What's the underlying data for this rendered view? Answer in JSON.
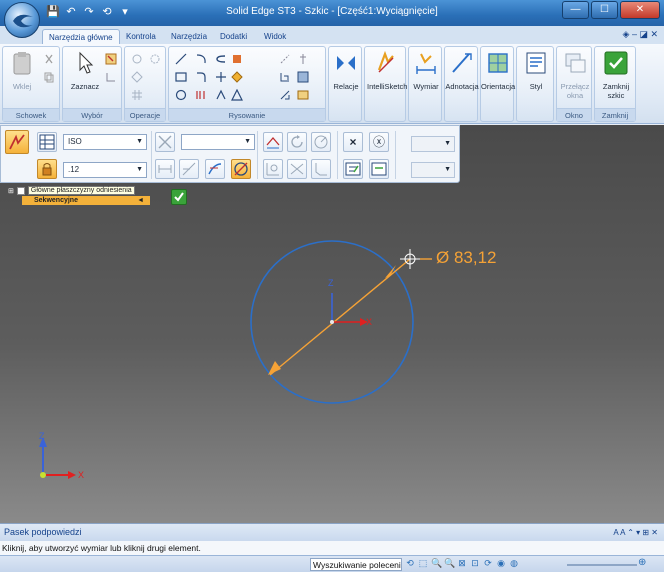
{
  "window": {
    "title": "Solid Edge ST3 - Szkic - [Część1:Wyciągnięcie]",
    "minimize": "—",
    "maximize": "☐",
    "close": "✕"
  },
  "qat": [
    "💾",
    "↶",
    "↷",
    "⟲",
    "▾"
  ],
  "tabs": [
    "Narzędzia główne",
    "Kontrola",
    "Narzędzia",
    "Dodatki",
    "Widok"
  ],
  "help_icons": "◈  –  ◪  ✕",
  "ribbon": {
    "groups": {
      "schowek": {
        "label": "Schowek",
        "wklej": "Wklej"
      },
      "wybor": {
        "label": "Wybór",
        "zaznacz": "Zaznacz"
      },
      "operacje": {
        "label": "Operacje"
      },
      "rysowanie": {
        "label": "Rysowanie"
      },
      "relacje": {
        "label": "Relacje"
      },
      "intellisketch": {
        "label": "IntelliSketch"
      },
      "wymiar": {
        "label": "Wymiar"
      },
      "adnotacja": {
        "label": "Adnotacja"
      },
      "orientacja": {
        "label": "Orientacja"
      },
      "styl": {
        "label": "Styl"
      },
      "okno": {
        "label": "Okno",
        "przelacz_okna_1": "Przełącz",
        "przelacz_okna_2": "okna"
      },
      "zamknij": {
        "label": "Zamknij",
        "zamknij_szkic_1": "Zamknij",
        "zamknij_szkic_2": "szkic"
      }
    }
  },
  "command_bar": {
    "standard": "ISO",
    "value": ".12",
    "btn_x": "×",
    "btn_xc": "ⓧ"
  },
  "tree": {
    "tooltip": "Główne płaszczyzny odniesienia",
    "sequential": "Sekwencyjne"
  },
  "sketch": {
    "dimension": "Ø 83,12",
    "axis_z": "Z",
    "axis_x": "X",
    "colors": {
      "circle": "#2b6fc9",
      "dimension": "#f5a236",
      "axis_z": "#3a63d8",
      "axis_x": "#e02020"
    }
  },
  "prompt": {
    "title": "Pasek podpowiedzi",
    "tools": "A A ⌃ ▾ ⊞ ✕",
    "message": "Kliknij, aby utworzyć wymiar lub kliknij drugi element."
  },
  "status": {
    "search": "Wyszukiwanie polecenia",
    "icons": [
      "⟲",
      "⬚",
      "🔍",
      "🔍",
      "⊠",
      "⊡",
      "⟳",
      "◉",
      "◍"
    ],
    "zoom_plus": "⊕"
  }
}
